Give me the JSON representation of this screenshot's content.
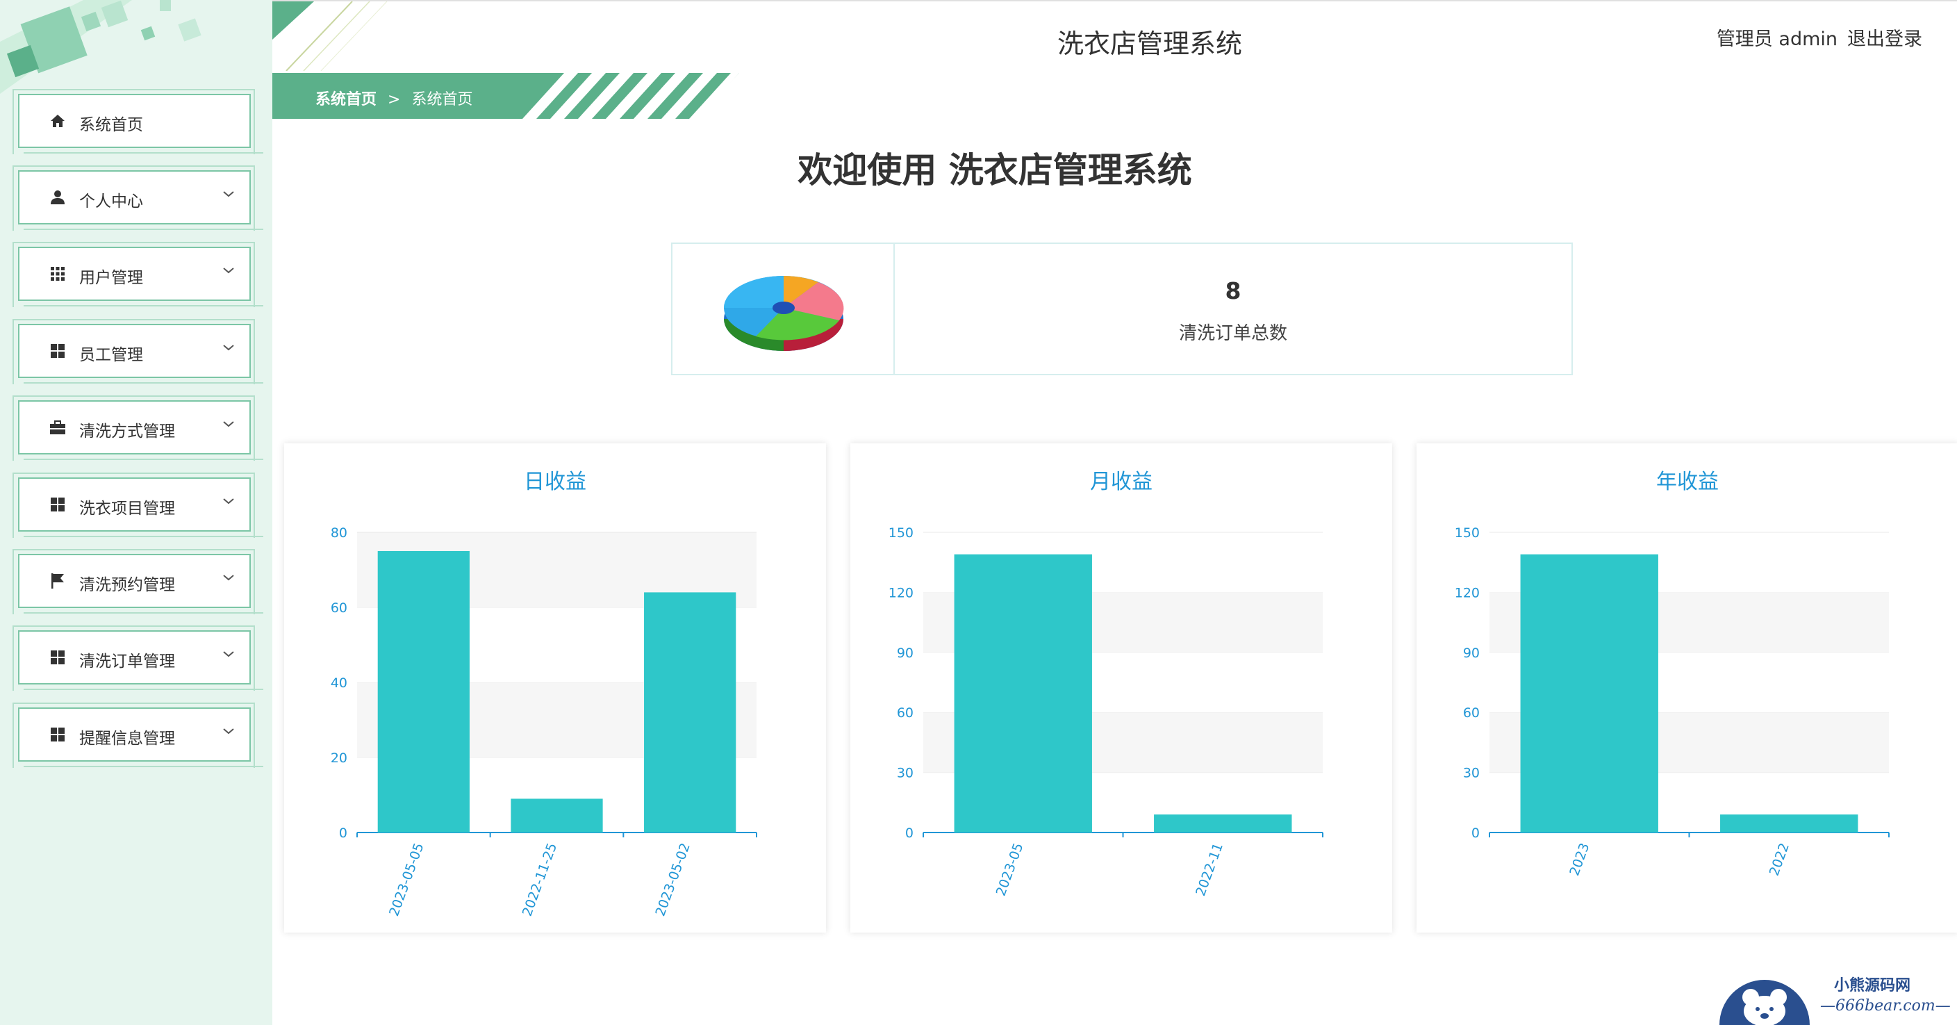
{
  "app": {
    "title": "洗衣店管理系统",
    "user_label": "管理员 admin",
    "logout_label": "退出登录"
  },
  "breadcrumb": {
    "root": "系统首页",
    "separator": ">",
    "current": "系统首页"
  },
  "welcome": "欢迎使用 洗衣店管理系统",
  "stat": {
    "value": "8",
    "label": "清洗订单总数",
    "icon": "pie-chart-3d-icon"
  },
  "sidebar": {
    "items": [
      {
        "label": "系统首页",
        "icon": "home-icon",
        "expandable": false
      },
      {
        "label": "个人中心",
        "icon": "user-icon",
        "expandable": true
      },
      {
        "label": "用户管理",
        "icon": "grid-icon",
        "expandable": true
      },
      {
        "label": "员工管理",
        "icon": "apps-icon",
        "expandable": true
      },
      {
        "label": "清洗方式管理",
        "icon": "briefcase-icon",
        "expandable": true
      },
      {
        "label": "洗衣项目管理",
        "icon": "apps-icon",
        "expandable": true
      },
      {
        "label": "清洗预约管理",
        "icon": "flag-icon",
        "expandable": true
      },
      {
        "label": "清洗订单管理",
        "icon": "apps-icon",
        "expandable": true
      },
      {
        "label": "提醒信息管理",
        "icon": "apps-icon",
        "expandable": true
      }
    ]
  },
  "colors": {
    "accent": "#5bb08a",
    "bar": "#2ec7c9",
    "chart_text": "#2196d6",
    "sidebar_bg": "#e6f5ee"
  },
  "chart_data": [
    {
      "type": "bar",
      "title": "日收益",
      "categories": [
        "2023-05-05",
        "2022-11-25",
        "2023-05-02"
      ],
      "values": [
        75,
        9,
        64
      ],
      "ylim": [
        0,
        80
      ],
      "yticks": [
        0,
        20,
        40,
        60,
        80
      ],
      "grid": true
    },
    {
      "type": "bar",
      "title": "月收益",
      "categories": [
        "2023-05",
        "2022-11"
      ],
      "values": [
        139,
        9
      ],
      "ylim": [
        0,
        150
      ],
      "yticks": [
        0,
        30,
        60,
        90,
        120,
        150
      ],
      "grid": true
    },
    {
      "type": "bar",
      "title": "年收益",
      "categories": [
        "2023",
        "2022"
      ],
      "values": [
        139,
        9
      ],
      "ylim": [
        0,
        150
      ],
      "yticks": [
        0,
        30,
        60,
        90,
        120,
        150
      ],
      "grid": true
    }
  ],
  "watermark": {
    "line1": "小熊源码网",
    "line2": "—666bear.com—"
  }
}
